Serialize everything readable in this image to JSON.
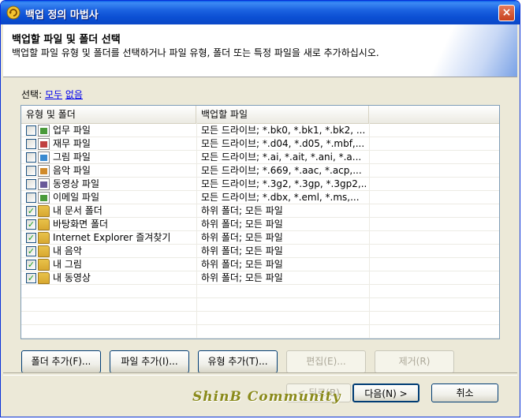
{
  "window": {
    "title": "백업 정의 마법사",
    "close_glyph": "×"
  },
  "header": {
    "title": "백업할 파일 및 폴더 선택",
    "description": "백업할 파일 유형 및 폴더를 선택하거나 파일 유형, 폴더 또는 특정 파일을 새로 추가하십시오."
  },
  "select": {
    "label": "선택:",
    "all": "모두",
    "none": "없음"
  },
  "list": {
    "columns": [
      "유형 및 폴더",
      "백업할 파일",
      ""
    ],
    "rows": [
      {
        "name": "업무 파일",
        "files": "모든 드라이브; *.bk0, *.bk1, *.bk2, ...",
        "checked": false,
        "icon": "document-file-icon",
        "color": "#4a9a3a"
      },
      {
        "name": "재무 파일",
        "files": "모든 드라이브; *.d04, *.d05, *.mbf,...",
        "checked": false,
        "icon": "finance-chart-icon",
        "color": "#c04040"
      },
      {
        "name": "그림 파일",
        "files": "모든 드라이브; *.ai, *.ait, *.ani, *.a...",
        "checked": false,
        "icon": "picture-file-icon",
        "color": "#3a8ad0"
      },
      {
        "name": "음악 파일",
        "files": "모든 드라이브; *.669, *.aac, *.acp,...",
        "checked": false,
        "icon": "music-file-icon",
        "color": "#d08a2a"
      },
      {
        "name": "동영상 파일",
        "files": "모든 드라이브; *.3g2, *.3gp, *.3gp2,...",
        "checked": false,
        "icon": "video-file-icon",
        "color": "#6a5a9a"
      },
      {
        "name": "이메일 파일",
        "files": "모든 드라이브; *.dbx, *.eml, *.ms,...",
        "checked": false,
        "icon": "email-file-icon",
        "color": "#4a9a3a"
      },
      {
        "name": "내 문서 폴더",
        "files": "하위 폴더; 모든 파일",
        "checked": true,
        "icon": "my-documents-folder-icon",
        "color": "#e8c24a"
      },
      {
        "name": "바탕화면 폴더",
        "files": "하위 폴더; 모든 파일",
        "checked": true,
        "icon": "desktop-folder-icon",
        "color": "#e8c24a"
      },
      {
        "name": "Internet Explorer 즐겨찾기",
        "files": "하위 폴더; 모든 파일",
        "checked": true,
        "icon": "favorites-folder-icon",
        "color": "#e8c24a"
      },
      {
        "name": "내 음악",
        "files": "하위 폴더; 모든 파일",
        "checked": true,
        "icon": "my-music-folder-icon",
        "color": "#e8c24a"
      },
      {
        "name": "내 그림",
        "files": "하위 폴더; 모든 파일",
        "checked": true,
        "icon": "my-pictures-folder-icon",
        "color": "#e8c24a"
      },
      {
        "name": "내 동영상",
        "files": "하위 폴더; 모든 파일",
        "checked": true,
        "icon": "my-videos-folder-icon",
        "color": "#e8c24a"
      }
    ]
  },
  "actions": {
    "add_folder": "폴더 추가(F)...",
    "add_file": "파일 추가(I)...",
    "add_type": "유형 추가(T)...",
    "edit": "편집(E)...",
    "remove": "제거(R)"
  },
  "footer": {
    "back": "< 뒤로(B)",
    "next": "다음(N) >",
    "cancel": "취소"
  },
  "watermark": "ShinB Community"
}
